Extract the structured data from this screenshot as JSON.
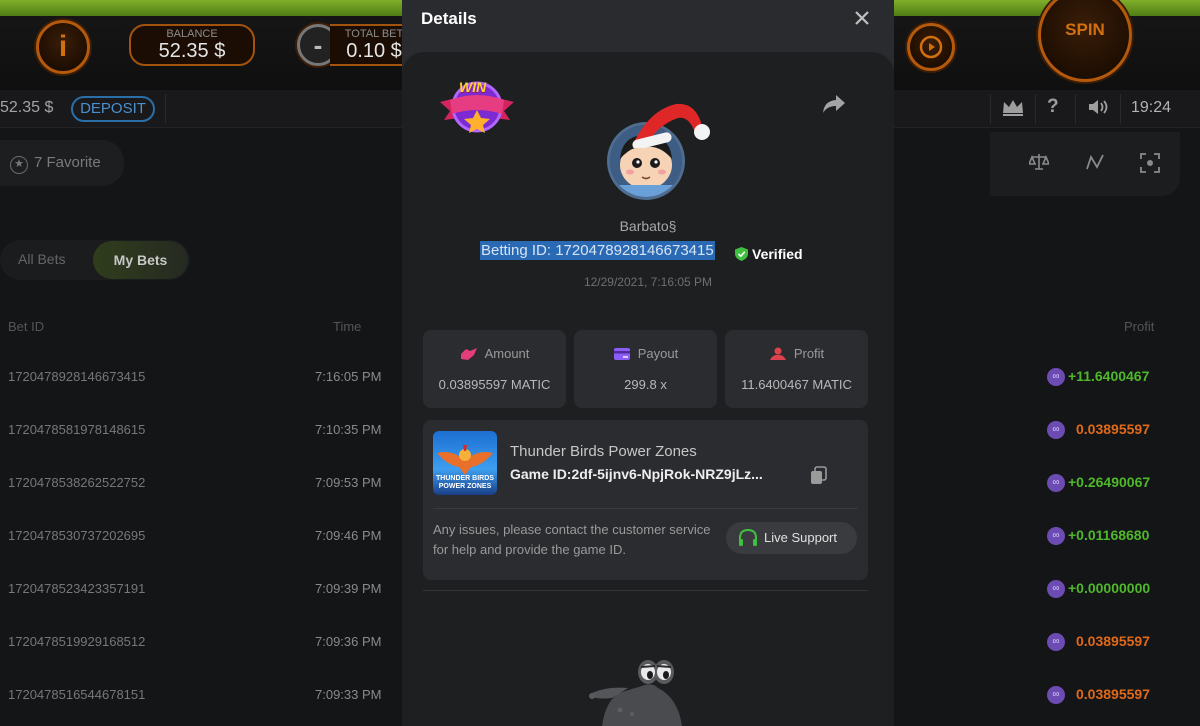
{
  "game_bar": {
    "balance_label": "BALANCE",
    "balance_value": "52.35 $",
    "total_bet_label": "TOTAL BET",
    "total_bet_value": "0.10 $",
    "spin_label": "SPIN",
    "info_icon": "i",
    "minus_icon": "-"
  },
  "top_row": {
    "balance": "52.35 $",
    "deposit_label": "DEPOSIT",
    "clock": "19:24",
    "icons": [
      "crown-icon",
      "help-icon",
      "volume-icon"
    ]
  },
  "background": {
    "favorite_label": "7 Favorite",
    "tabs": [
      "All Bets",
      "My Bets"
    ],
    "columns": {
      "bet_id": "Bet ID",
      "time": "Time",
      "profit": "Profit"
    },
    "rows": [
      {
        "id": "1720478928146673415",
        "time": "7:16:05 PM",
        "profit": "+11.6400467",
        "positive": true
      },
      {
        "id": "1720478581978148615",
        "time": "7:10:35 PM",
        "profit": "0.03895597",
        "positive": false
      },
      {
        "id": "1720478538262522752",
        "time": "7:09:53 PM",
        "profit": "+0.26490067",
        "positive": true
      },
      {
        "id": "1720478530737202695",
        "time": "7:09:46 PM",
        "profit": "+0.01168680",
        "positive": true
      },
      {
        "id": "1720478523423357191",
        "time": "7:09:39 PM",
        "profit": "+0.00000000",
        "positive": true
      },
      {
        "id": "1720478519929168512",
        "time": "7:09:36 PM",
        "profit": "0.03895597",
        "positive": false
      },
      {
        "id": "1720478516544678151",
        "time": "7:09:33 PM",
        "profit": "0.03895597",
        "positive": false
      }
    ],
    "colors": {
      "positive": "#4fb82a",
      "negative": "#e06a1a"
    }
  },
  "modal": {
    "title": "Details",
    "win_badge": "WIN",
    "username": "Barbato§",
    "betting_id_text": "Betting ID: 1720478928146673415",
    "verified_label": "Verified",
    "bet_datetime": "12/29/2021, 7:16:05 PM",
    "stats": [
      {
        "label": "Amount",
        "value": "0.03895597 MATIC"
      },
      {
        "label": "Payout",
        "value": "299.8 x"
      },
      {
        "label": "Profit",
        "value": "11.6400467 MATIC"
      }
    ],
    "game": {
      "name": "Thunder Birds Power Zones",
      "game_id": "Game ID:2df-5ijnv6-NpjRok-NRZ9jLz...",
      "thumb_caption_1": "THUNDER BIRDS",
      "thumb_caption_2": "POWER ZONES"
    },
    "support_text": "Any issues, please contact the customer service for help and provide the game ID.",
    "live_support_label": "Live Support",
    "colors": {
      "accent_pink": "#e53c7a",
      "accent_purple": "#8b5cf6",
      "accent_red": "#e0424d",
      "verified_green": "#3fbf3f",
      "highlight_blue": "#2a6ab4"
    }
  }
}
